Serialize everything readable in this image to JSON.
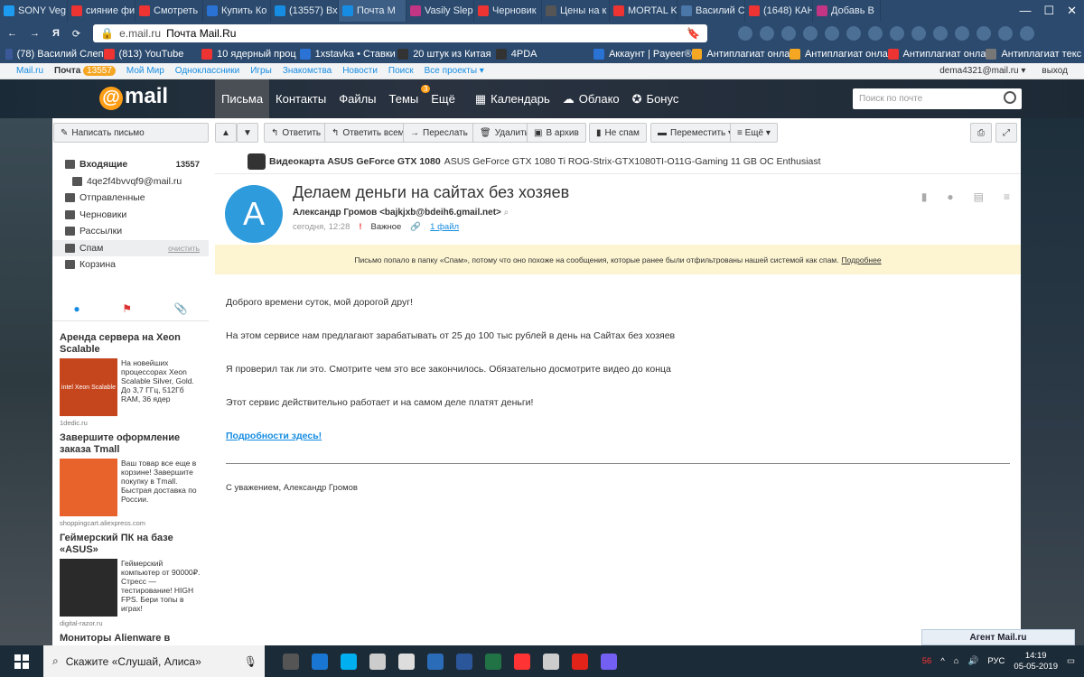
{
  "browser": {
    "tabs": [
      {
        "label": "SONY Veg",
        "color": "#1d9bf0"
      },
      {
        "label": "сияние фи",
        "color": "#e33"
      },
      {
        "label": "Смотреть",
        "color": "#e33"
      },
      {
        "label": "Купить Ко",
        "color": "#2a72d4"
      },
      {
        "label": "(13557) Вх",
        "color": "#168de2"
      },
      {
        "label": "Почта М",
        "color": "#168de2"
      },
      {
        "label": "Vasily Slep",
        "color": "#c13584"
      },
      {
        "label": "Черновик",
        "color": "#e33"
      },
      {
        "label": "Цены на к",
        "color": "#555"
      },
      {
        "label": "MORTAL K",
        "color": "#e33"
      },
      {
        "label": "Василий С",
        "color": "#4a76a8"
      },
      {
        "label": "(1648) КАН",
        "color": "#e33"
      },
      {
        "label": "Добавь В",
        "color": "#c13584"
      }
    ],
    "active_tab_index": 5,
    "url_domain": "e.mail.ru",
    "url_title": "Почта Mail.Ru",
    "bookmarks": [
      {
        "label": "(78) Василий Слеп",
        "color": "#3b5998"
      },
      {
        "label": "(813) YouTube",
        "color": "#e33"
      },
      {
        "label": "10 ядерный проц",
        "color": "#e33"
      },
      {
        "label": "1xstavka • Ставки",
        "color": "#2a72d4"
      },
      {
        "label": "20 штук из Китая",
        "color": "#333"
      },
      {
        "label": "4PDA",
        "color": "#333"
      },
      {
        "label": "Аккаунт | Payeer®",
        "color": "#2a72d4"
      },
      {
        "label": "Антиплагиат онла",
        "color": "#f5a623"
      },
      {
        "label": "Антиплагиат онла",
        "color": "#f5a623"
      },
      {
        "label": "Антиплагиат онла",
        "color": "#e33"
      },
      {
        "label": "Антиплагиат текс",
        "color": "#777"
      }
    ]
  },
  "portal": {
    "links": [
      "Mail.ru",
      "Почта",
      "Мой Мир",
      "Одноклассники",
      "Игры",
      "Знакомства",
      "Новости",
      "Поиск",
      "Все проекты ▾"
    ],
    "badge": "13557",
    "user": "dema4321@mail.ru ▾",
    "logout": "выход"
  },
  "header": {
    "logo": "mail",
    "nav": [
      "Письма",
      "Контакты",
      "Файлы",
      "Темы",
      "Ещё"
    ],
    "more_count": "3",
    "services": [
      "Календарь",
      "Облако",
      "Бонус"
    ],
    "search_placeholder": "Поиск по почте"
  },
  "toolbar": {
    "compose": "Написать письмо",
    "reply": "Ответить",
    "reply_all": "Ответить всем",
    "forward": "Переслать",
    "delete": "Удалить",
    "archive": "В архив",
    "not_spam": "Не спам",
    "move": "Переместить ▾",
    "more": "≡ Ещё ▾"
  },
  "folders": [
    {
      "label": "Входящие",
      "count": "13557",
      "bold": true
    },
    {
      "label": "4qe2f4bvvqf9@mail.ru",
      "count": "",
      "bold": false
    },
    {
      "label": "Отправленные",
      "count": "",
      "bold": false
    },
    {
      "label": "Черновики",
      "count": "",
      "bold": false
    },
    {
      "label": "Рассылки",
      "count": "",
      "bold": false
    },
    {
      "label": "Спам",
      "count": "очистить",
      "bold": false
    },
    {
      "label": "Корзина",
      "count": "",
      "bold": false
    }
  ],
  "ads": [
    {
      "title": "Аренда сервера на Xeon Scalable",
      "text": "На новейших процессорах Xeon Scalable Silver, Gold. До 3,7 ГГц, 512Гб RAM, 36 ядер",
      "source": "1dedic.ru",
      "color": "#c5451d",
      "img_text": "intel Xeon Scalable"
    },
    {
      "title": "Завершите оформление заказа Tmall",
      "text": "Ваш товар все еще в корзине! Завершите покупку в Tmall. Быстрая доставка по России.",
      "source": "shoppingcart.aliexpress.com",
      "color": "#e8622c",
      "img_text": ""
    },
    {
      "title": "Геймерский ПК на базе «ASUS»",
      "text": "Геймерский компьютер от 90000₽. Стресс — тестирование! HIGH FPS. Бери топы в играх!",
      "source": "digital-razor.ru",
      "color": "#2a2a2a",
      "img_text": ""
    },
    {
      "title": "Мониторы Alienware в Ситилинк!",
      "text": "",
      "source": "",
      "color": "#444",
      "img_text": ""
    }
  ],
  "ad_top_strip": {
    "label": "Видеокарта ASUS GeForce GTX 1080",
    "text": "ASUS GeForce GTX 1080 Ti ROG-Strix-GTX1080TI-O11G-Gaming 11 GB OC Enthusiast"
  },
  "message": {
    "avatar_letter": "А",
    "subject": "Делаем деньги на сайтах без хозяев",
    "from": "Александр Громов <bajkjxb@bdeih6.gmail.net>",
    "date": "сегодня, 12:28",
    "importance": "!",
    "importance_label": "Важное",
    "attachment": "1 файл",
    "spam_notice": "Письмо попало в папку «Спам», потому что оно похоже на сообщения, которые ранее были отфильтрованы нашей системой как спам.",
    "spam_link": "Подробнее",
    "body": [
      "Доброго времени суток, мой дорогой друг!",
      "На этом сервисе нам предлагают зарабатывать от 25 до 100 тыс рублей в день на Сайтах без хозяев",
      "Я проверил так ли это. Смотрите чем это все закончилось. Обязательно досмотрите видео до конца",
      "Этот сервис действительно работает и на самом деле платят деньги!"
    ],
    "link": "Подробности здесь!",
    "signature": "С уважением, Александр Громов"
  },
  "agent": "Агент Mail.ru",
  "taskbar": {
    "search": "Скажите «Слушай, Алиса»",
    "lang": "РУС",
    "time": "14:19",
    "date": "05-05-2019",
    "badge": "56"
  }
}
